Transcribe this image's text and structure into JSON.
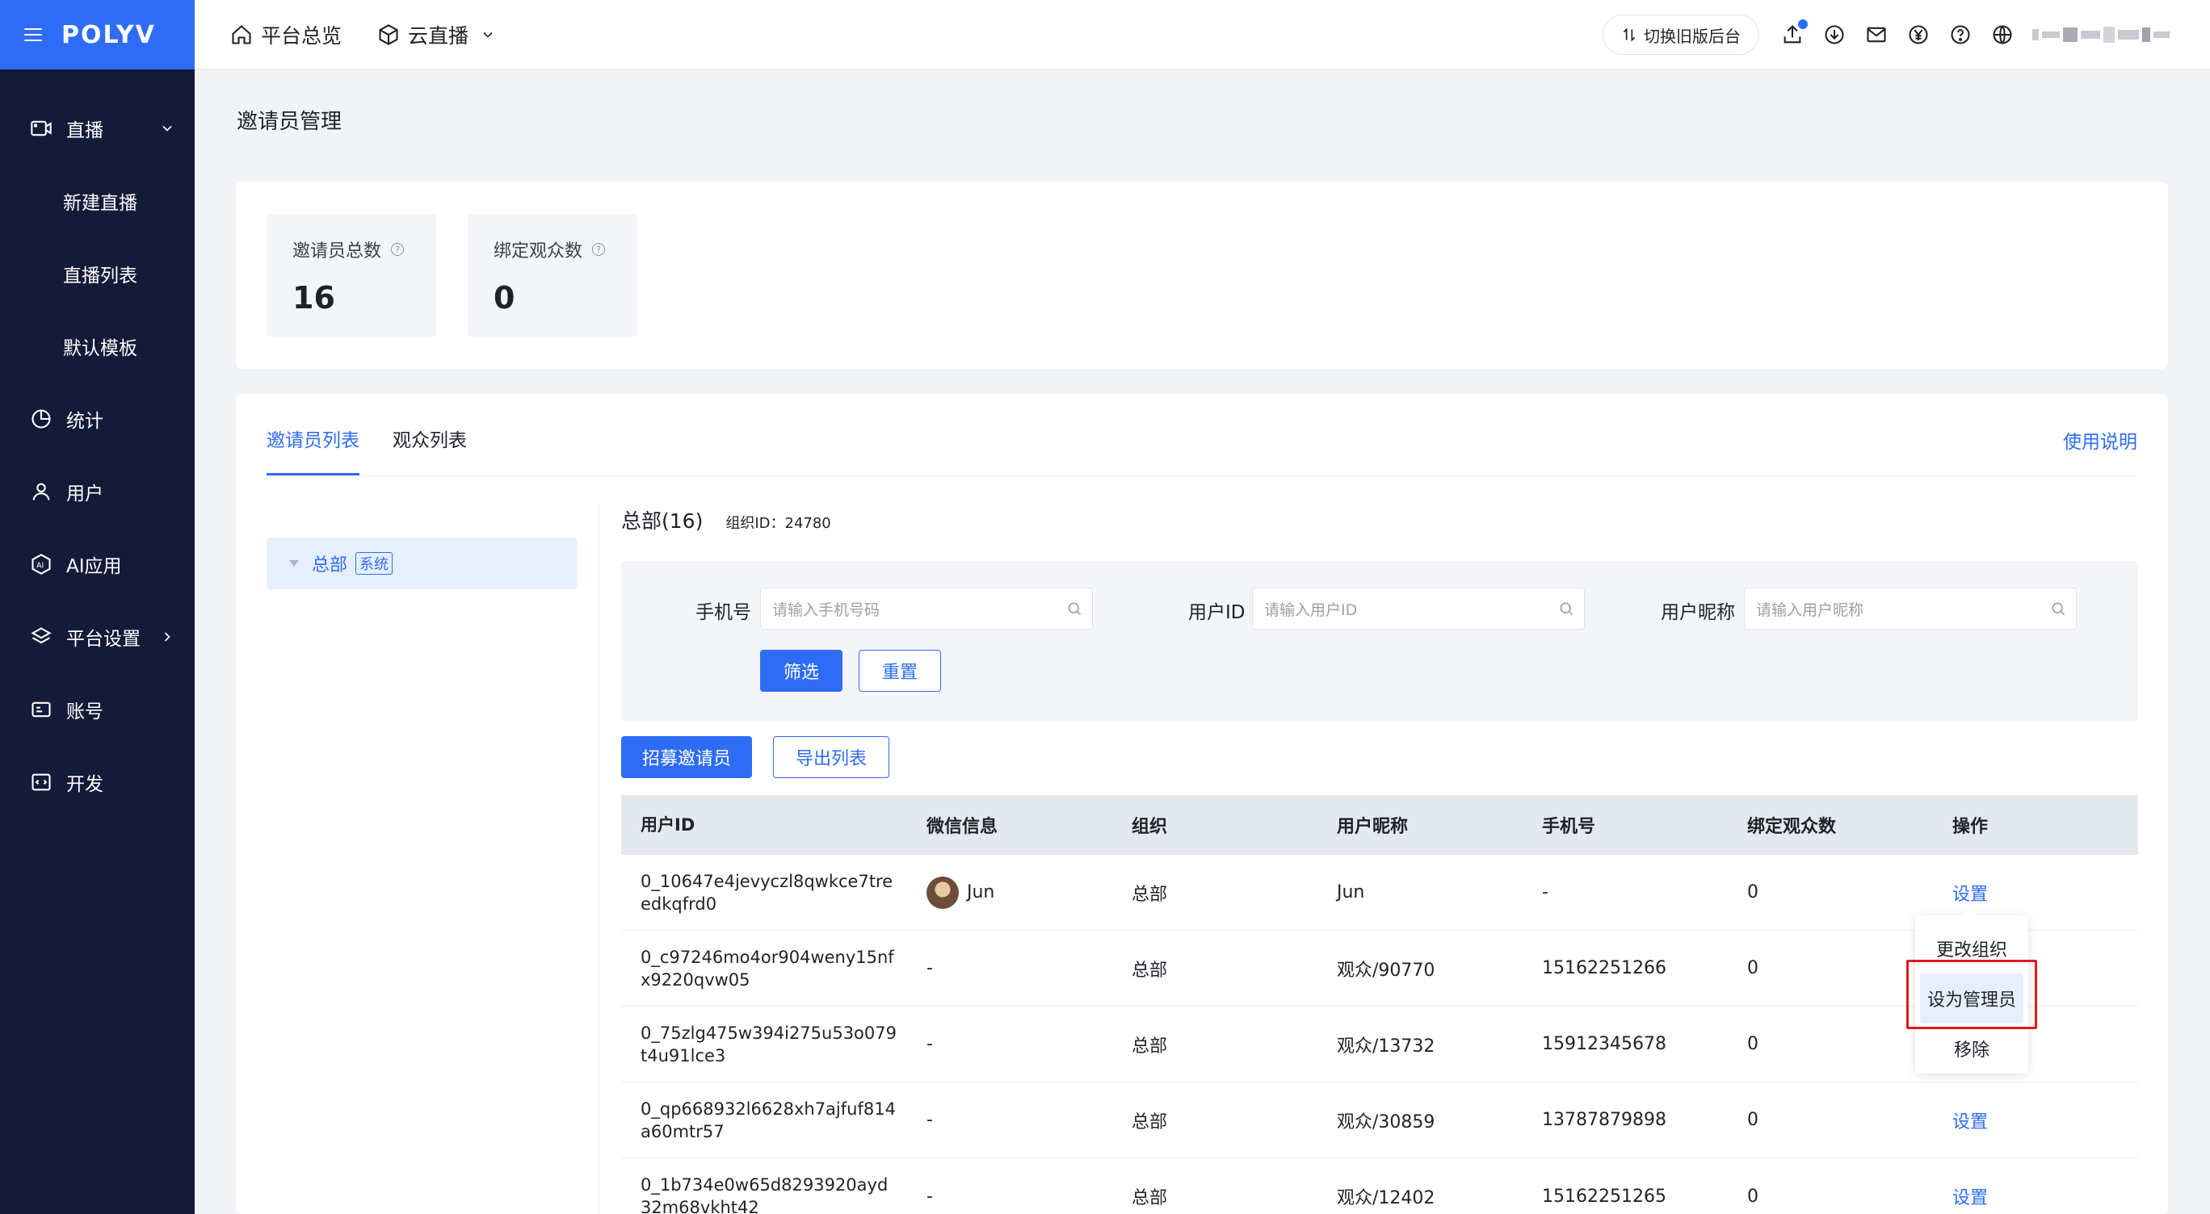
{
  "brand": {
    "logo": "POLYV",
    "color": "#2e6cf6"
  },
  "sidebar": {
    "items": [
      {
        "label": "直播",
        "icon": "live-camera-icon",
        "expanded": true
      },
      {
        "label": "新建直播",
        "sub": true
      },
      {
        "label": "直播列表",
        "sub": true
      },
      {
        "label": "默认模板",
        "sub": true
      },
      {
        "label": "统计",
        "icon": "pie-chart-icon"
      },
      {
        "label": "用户",
        "icon": "user-icon"
      },
      {
        "label": "AI应用",
        "icon": "ai-icon"
      },
      {
        "label": "平台设置",
        "icon": "layers-icon"
      },
      {
        "label": "账号",
        "icon": "id-card-icon"
      },
      {
        "label": "开发",
        "icon": "code-icon"
      }
    ]
  },
  "header": {
    "nav": [
      {
        "label": "平台总览",
        "icon": "home-icon"
      },
      {
        "label": "云直播",
        "icon": "cube-icon"
      }
    ],
    "switch_label": "切换旧版后台"
  },
  "page": {
    "title": "邀请员管理"
  },
  "stats": [
    {
      "label": "邀请员总数",
      "value": "16"
    },
    {
      "label": "绑定观众数",
      "value": "0"
    }
  ],
  "tabs": [
    {
      "label": "邀请员列表",
      "active": true
    },
    {
      "label": "观众列表",
      "active": false
    }
  ],
  "help_link": "使用说明",
  "tree": {
    "node": "总部",
    "tag": "系统"
  },
  "org": {
    "name": "总部(16)",
    "id_text": "组织ID：24780"
  },
  "filters": {
    "phone": {
      "label": "手机号",
      "placeholder": "请输入手机号码"
    },
    "userid": {
      "label": "用户ID",
      "placeholder": "请输入用户ID"
    },
    "nickname": {
      "label": "用户昵称",
      "placeholder": "请输入用户昵称"
    },
    "filter_btn": "筛选",
    "reset_btn": "重置"
  },
  "actions": {
    "recruit": "招募邀请员",
    "export": "导出列表"
  },
  "table": {
    "columns": [
      "用户ID",
      "微信信息",
      "组织",
      "用户昵称",
      "手机号",
      "绑定观众数",
      "操作"
    ],
    "rows": [
      {
        "id1": "0_10647e4jevyczl8qwkce7tre",
        "id2": "edkqfrd0",
        "wechat": "Jun",
        "org": "总部",
        "nickname": "Jun",
        "phone": "-",
        "count": "0",
        "op": "设置"
      },
      {
        "id1": "0_c97246mo4or904weny15nf",
        "id2": "x9220qvw05",
        "wechat": "-",
        "org": "总部",
        "nickname": "观众/90770",
        "phone": "15162251266",
        "count": "0",
        "op": ""
      },
      {
        "id1": "0_75zlg475w394i275u53o079",
        "id2": "t4u91lce3",
        "wechat": "-",
        "org": "总部",
        "nickname": "观众/13732",
        "phone": "15912345678",
        "count": "0",
        "op": ""
      },
      {
        "id1": "0_qp668932l6628xh7ajfuf814",
        "id2": "a60mtr57",
        "wechat": "-",
        "org": "总部",
        "nickname": "观众/30859",
        "phone": "13787879898",
        "count": "0",
        "op": "设置"
      },
      {
        "id1": "0_1b734e0w65d8293920ayd",
        "id2": "32m68vkht42",
        "wechat": "-",
        "org": "总部",
        "nickname": "观众/12402",
        "phone": "15162251265",
        "count": "0",
        "op": "设置"
      }
    ]
  },
  "dropdown": {
    "items": [
      "更改组织",
      "设为管理员",
      "移除"
    ]
  }
}
